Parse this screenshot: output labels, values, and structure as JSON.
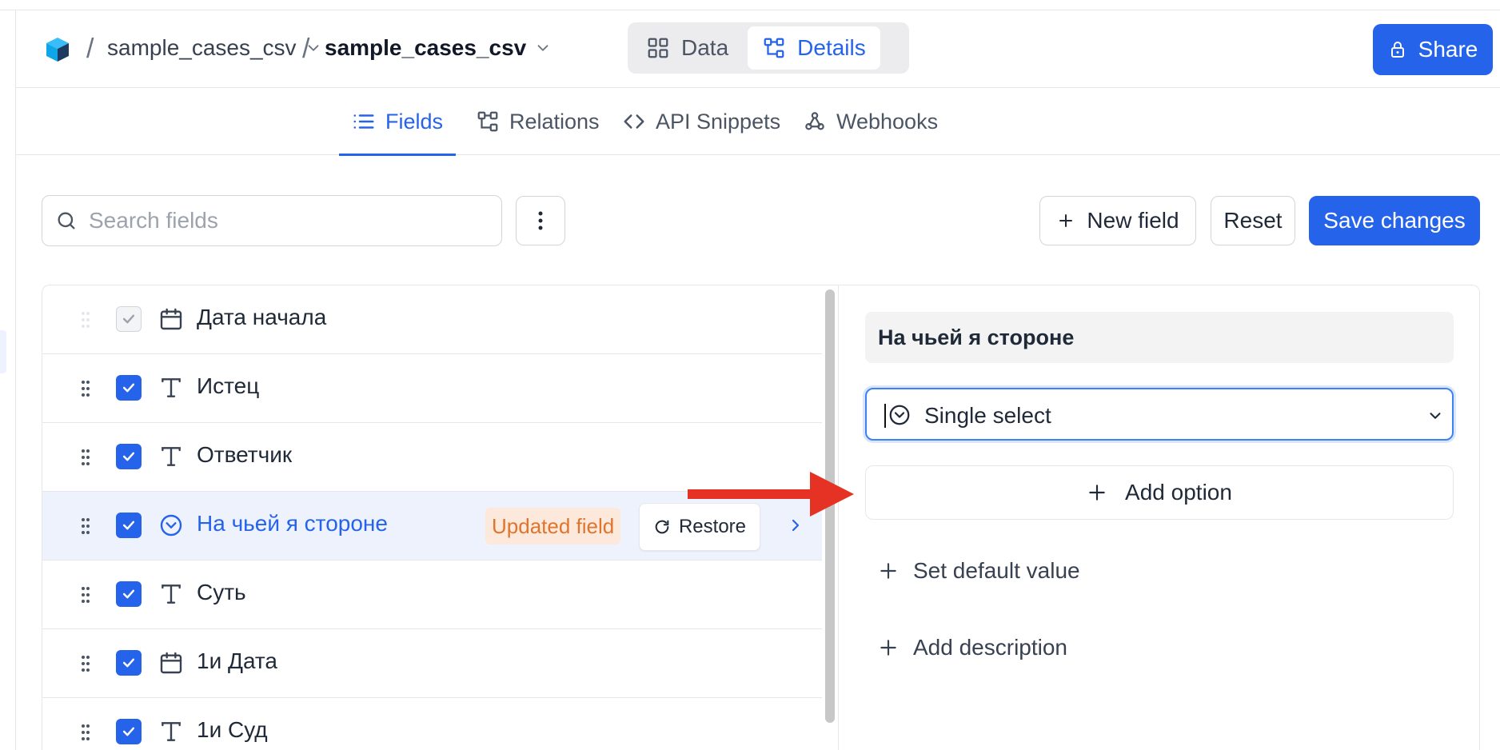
{
  "breadcrumb": {
    "project": "sample_cases_csv",
    "table": "sample_cases_csv"
  },
  "view_toggle": {
    "data_label": "Data",
    "details_label": "Details"
  },
  "share_label": "Share",
  "tabs": [
    {
      "label": "Fields",
      "active": true
    },
    {
      "label": "Relations",
      "active": false
    },
    {
      "label": "API Snippets",
      "active": false
    },
    {
      "label": "Webhooks",
      "active": false
    }
  ],
  "toolbar": {
    "search_placeholder": "Search fields",
    "new_field_label": "New field",
    "reset_label": "Reset",
    "save_label": "Save changes"
  },
  "fields": [
    {
      "name": "Дата начала",
      "type_icon": "calendar-icon",
      "checked": true,
      "disabled": true
    },
    {
      "name": "Истец",
      "type_icon": "text-type-icon",
      "checked": true
    },
    {
      "name": "Ответчик",
      "type_icon": "text-type-icon",
      "checked": true
    },
    {
      "name": "На чьей я стороне",
      "type_icon": "single-select-icon",
      "checked": true,
      "selected": true,
      "badge": "Updated field",
      "restore_label": "Restore"
    },
    {
      "name": "Суть",
      "type_icon": "text-type-icon",
      "checked": true
    },
    {
      "name": "1и Дата",
      "type_icon": "calendar-icon",
      "checked": true
    },
    {
      "name": "1и Суд",
      "type_icon": "text-type-icon",
      "checked": true
    }
  ],
  "detail": {
    "field_name": "На чьей я стороне",
    "field_type": "Single select",
    "add_option_label": "Add option",
    "set_default_label": "Set default value",
    "add_description_label": "Add description"
  },
  "colors": {
    "accent": "#2563eb",
    "badge_bg": "#fde9dc",
    "badge_text": "#e0742d",
    "arrow": "#e53224"
  }
}
